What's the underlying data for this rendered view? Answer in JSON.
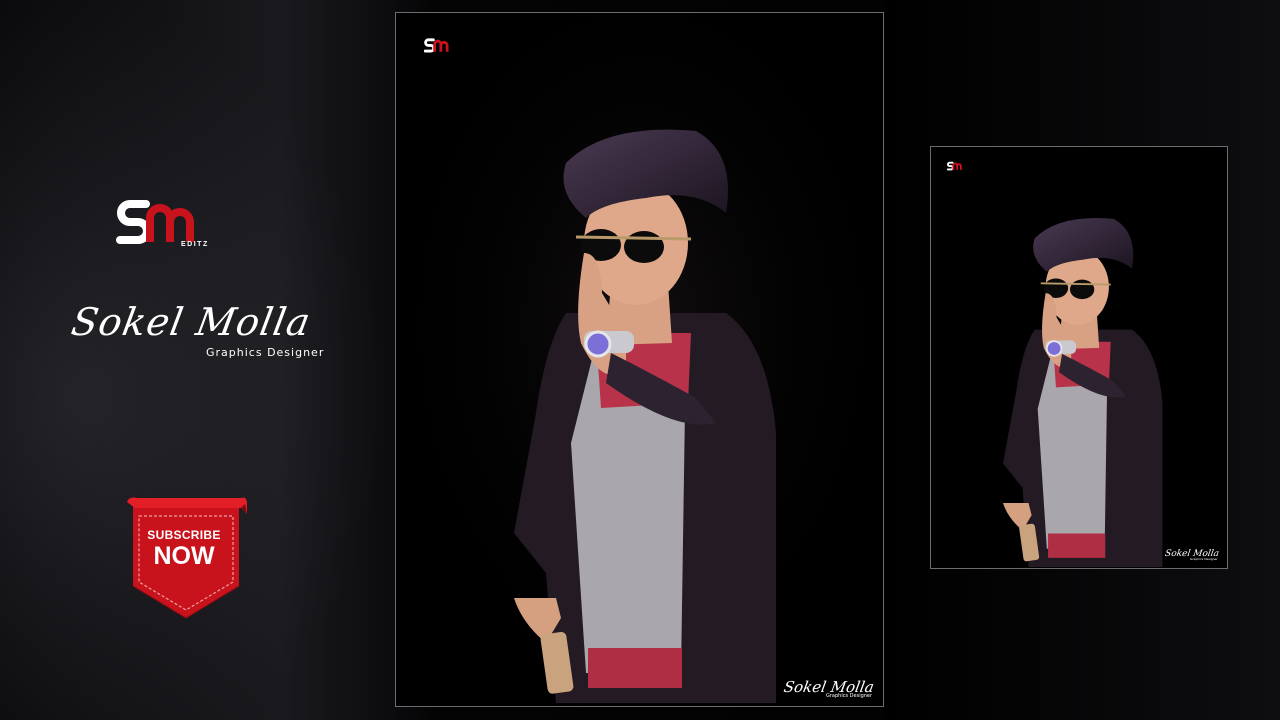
{
  "logo": {
    "letters": "SM",
    "tag": "EDITZ"
  },
  "signature": {
    "name": "Sokel Molla",
    "role": "Graphics Designer"
  },
  "subscribe": {
    "line1": "SUBSCRIBE",
    "line2": "NOW"
  },
  "colors": {
    "accent_red": "#c8121c",
    "background": "#000000",
    "poster_border": "#6c6c70",
    "shirt_red": "#b8334a",
    "shirt_gray": "#a9a7ab",
    "jacket": "#2a1f2a"
  }
}
